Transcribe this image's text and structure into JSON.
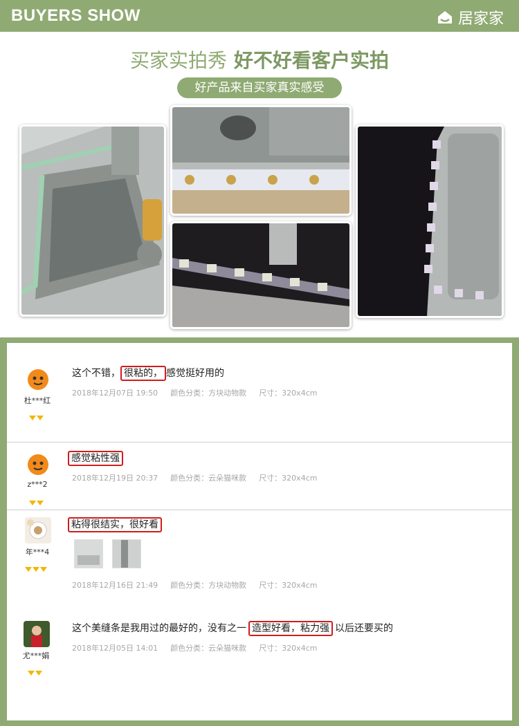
{
  "header": {
    "title": "BUYERS SHOW",
    "brand": "居家家"
  },
  "headline": {
    "part1": "买家实拍秀",
    "part2": "好不好看客户实拍"
  },
  "subtitle": "好产品来自买家真实感受",
  "reviews": [
    {
      "user": "杜***红",
      "text_before": "这个不错，",
      "highlight": "很粘的，",
      "text_after": "感觉挺好用的",
      "date": "2018年12月07日 19:50",
      "color": "颜色分类：方块动物款",
      "size": "尺寸：320x4cm"
    },
    {
      "user": "z***2",
      "text_before": "",
      "highlight": "感觉粘性强",
      "text_after": "",
      "date": "2018年12月19日 20:37",
      "color": "颜色分类：云朵猫咪款",
      "size": "尺寸：320x4cm"
    },
    {
      "user": "年***4",
      "text_before": "",
      "highlight": "粘得很结实，很好看",
      "text_after": "",
      "date": "2018年12月16日 21:49",
      "color": "颜色分类：方块动物款",
      "size": "尺寸：320x4cm"
    },
    {
      "user": "尤***娟",
      "text_before": "这个美缝条是我用过的最好的，没有之一",
      "highlight": "造型好看，粘力强",
      "text_after": "以后还要买的",
      "date": "2018年12月05日 14:01",
      "color": "颜色分类：云朵猫咪款",
      "size": "尺寸：320x4cm"
    }
  ],
  "colors": {
    "accent": "#8faa73",
    "highlight_border": "#d21b1b",
    "gem": "#f2b705"
  }
}
